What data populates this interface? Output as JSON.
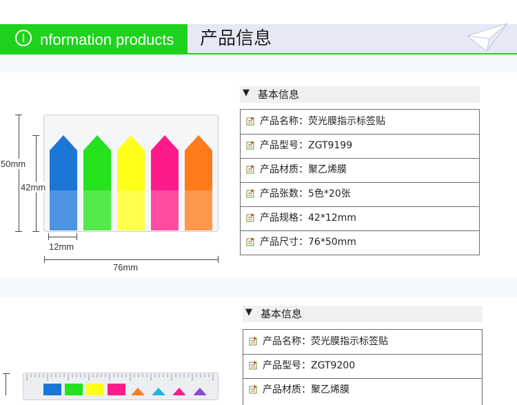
{
  "header": {
    "title_en": "nformation products",
    "title_cn": "产品信息"
  },
  "colors": {
    "accent_green": "#1ed21e",
    "header_bg": "#e6e8f6",
    "flags": [
      "#1a77d6",
      "#24e21c",
      "#ffff1a",
      "#ff1a8a",
      "#ff7a1a"
    ]
  },
  "image1": {
    "dim_height_outer": "50mm",
    "dim_height_inner": "42mm",
    "dim_flag_width": "12mm",
    "dim_width": "76mm"
  },
  "section1": {
    "heading": "基本信息",
    "rows": [
      {
        "label": "产品名称：荧光膜指示标签贴"
      },
      {
        "label": "产品型号：ZGT9199"
      },
      {
        "label": "产品材质：聚乙烯膜"
      },
      {
        "label": "产品张数：5色*20张"
      },
      {
        "label": "产品规格：42*12mm"
      },
      {
        "label": "产品尺寸：76*50mm"
      }
    ]
  },
  "section2": {
    "heading": "基本信息",
    "rows": [
      {
        "label": "产品名称：荧光膜指示标签贴"
      },
      {
        "label": "产品型号：ZGT9200"
      },
      {
        "label": "产品材质：聚乙烯膜"
      }
    ]
  }
}
